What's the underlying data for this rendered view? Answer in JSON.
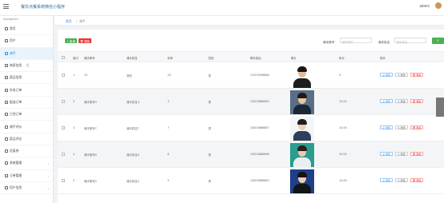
{
  "app": {
    "title": "餐饮点餐系统微信小程序",
    "user": "admin"
  },
  "sidebar": {
    "heading": "Navigation",
    "items": [
      {
        "label": "首页",
        "icon": "home-icon",
        "chev": ""
      },
      {
        "label": "用户",
        "icon": "user-icon",
        "chev": ""
      },
      {
        "label": "骑手",
        "icon": "rider-icon",
        "chev": "",
        "active": true
      },
      {
        "label": "商家信息",
        "icon": "store-icon",
        "chev": ""
      },
      {
        "label": "菜品信息",
        "icon": "dish-icon",
        "chev": ""
      },
      {
        "label": "外卖订单",
        "icon": "order-icon",
        "chev": ""
      },
      {
        "label": "配送订单",
        "icon": "delivery-icon",
        "chev": ""
      },
      {
        "label": "已完订单",
        "icon": "done-icon",
        "chev": ""
      },
      {
        "label": "骑手评价",
        "icon": "review-icon",
        "chev": ""
      },
      {
        "label": "菜品评论",
        "icon": "comment-icon",
        "chev": ""
      },
      {
        "label": "优惠券",
        "icon": "coupon-icon",
        "chev": ""
      },
      {
        "label": "系统管理",
        "icon": "settings-icon",
        "chev": "⌄"
      },
      {
        "label": "订单管理",
        "icon": "orders-icon",
        "chev": "⌄"
      },
      {
        "label": "用户信息",
        "icon": "profile-icon",
        "chev": "⌄"
      }
    ]
  },
  "breadcrumb": {
    "home": "首页",
    "sep": "/",
    "current": "骑手"
  },
  "toolbar": {
    "add_label": "+ 新增",
    "delete_label": "🗑 删除",
    "filter1_label": "骑手账号",
    "filter1_placeholder": "骑手账号",
    "filter2_label": "骑手姓名",
    "filter2_placeholder": "骑手姓名",
    "search_icon": "⌕"
  },
  "table": {
    "headers": [
      "索引",
      "骑手账号",
      "骑手姓名",
      "年龄",
      "性别",
      "联系电话",
      "照片",
      "积分",
      "操作"
    ],
    "rows": [
      {
        "idx": "1",
        "account": "22",
        "name": "张旺",
        "age": "23",
        "gender": "男",
        "phone": "11915556688",
        "points": "0",
        "alt": false,
        "photo_bg": "#ffffff",
        "shirt": "#1d1d1d",
        "skin": "#e3b99b",
        "hair": "#1a1614"
      },
      {
        "idx": "2",
        "account": "骑手账号3",
        "name": "骑手姓名3",
        "age": "3",
        "gender": "男",
        "phone": "13823888883",
        "points": "10.00",
        "alt": true,
        "photo_bg": "#5a6f86",
        "shirt": "#1b2738",
        "skin": "#e9c4a6",
        "hair": "#201a17"
      },
      {
        "idx": "3",
        "account": "骑手账号7",
        "name": "骑手姓名7",
        "age": "7",
        "gender": "男",
        "phone": "13823888887",
        "points": "10.00",
        "alt": false,
        "photo_bg": "#f3f6f8",
        "shirt": "#2e3f5c",
        "skin": "#f0cfb7",
        "hair": "#241c18"
      },
      {
        "idx": "4",
        "account": "骑手账号6",
        "name": "骑手姓名6",
        "age": "6",
        "gender": "男",
        "phone": "13823888886",
        "points": "10.00",
        "alt": true,
        "photo_bg": "#2a9d8f",
        "shirt": "#e9eef3",
        "skin": "#eecbb0",
        "hair": "#2a211c"
      },
      {
        "idx": "5",
        "account": "骑手账号5",
        "name": "骑手姓名5",
        "age": "5",
        "gender": "男",
        "phone": "13823888885",
        "points": "10.00",
        "alt": false,
        "photo_bg": "#1f3f87",
        "shirt": "#111418",
        "skin": "#efcdb5",
        "hair": "#16120f"
      }
    ],
    "action_detail": "≡ 详情",
    "action_edit": "✎ 修改",
    "action_delete": "🗑 删除"
  },
  "colors": {
    "accent": "#2d8cf0",
    "add": "#4caf50",
    "danger": "#e53935"
  }
}
